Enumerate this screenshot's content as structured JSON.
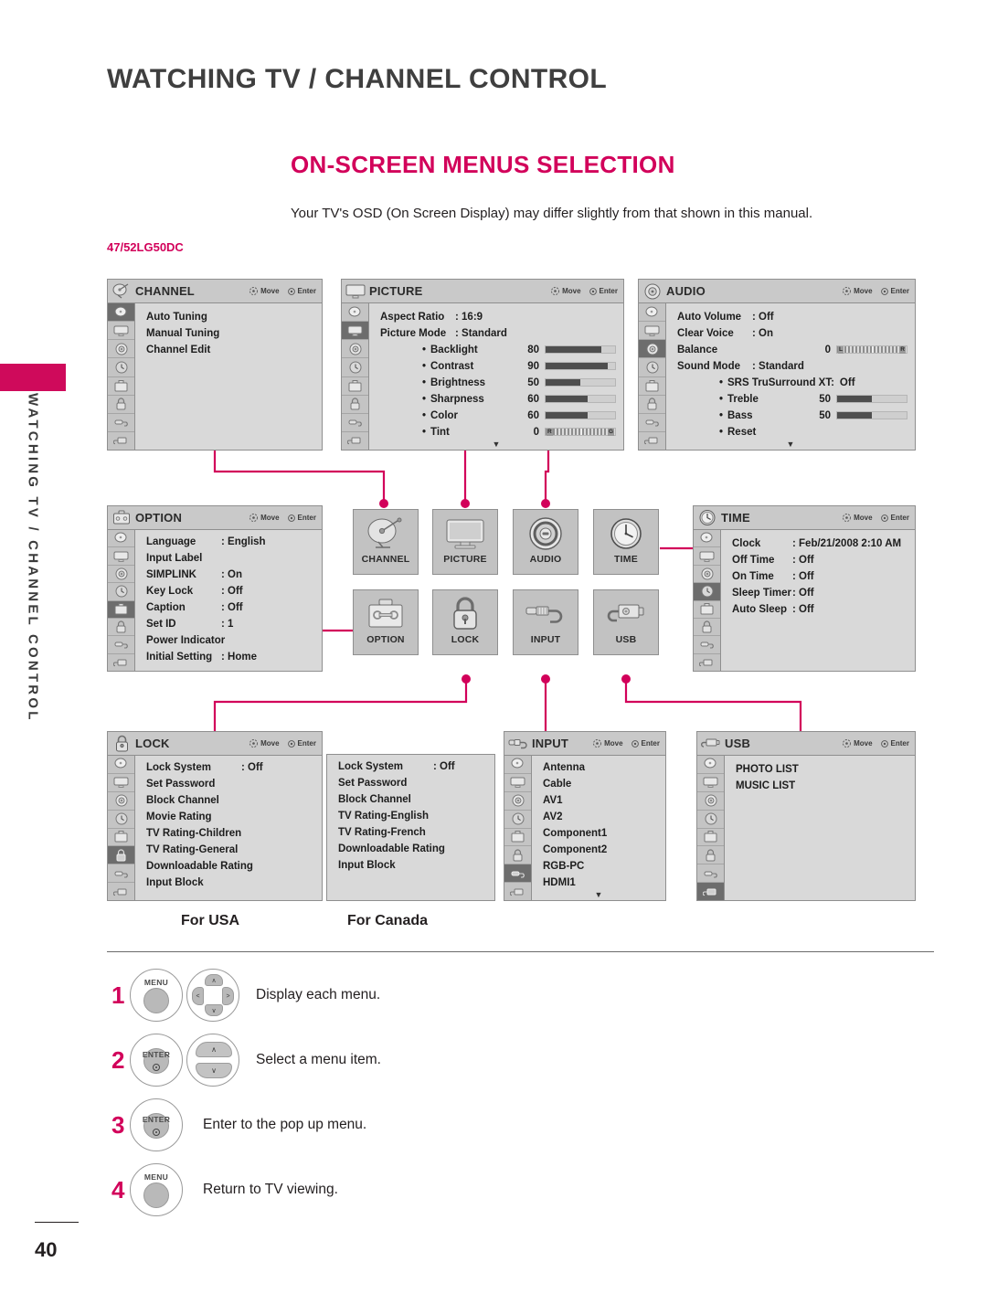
{
  "page": {
    "chapter_title": "WATCHING TV / CHANNEL CONTROL",
    "section_title": "ON-SCREEN MENUS SELECTION",
    "intro": "Your TV's OSD (On Screen Display) may differ slightly from that shown in this manual.",
    "model": "47/52LG50DC",
    "sidebar_vertical": "WATCHING TV / CHANNEL CONTROL",
    "page_number": "40",
    "accent_color": "#d2005a"
  },
  "osd_keys": {
    "move": "Move",
    "enter": "Enter"
  },
  "panels": {
    "channel": {
      "title": "CHANNEL",
      "items": [
        {
          "label": "Auto Tuning"
        },
        {
          "label": "Manual Tuning"
        },
        {
          "label": "Channel Edit"
        }
      ]
    },
    "picture": {
      "title": "PICTURE",
      "items": [
        {
          "label": "Aspect Ratio",
          "value": ": 16:9"
        },
        {
          "label": "Picture Mode",
          "value": ": Standard"
        }
      ],
      "sliders": [
        {
          "label": "Backlight",
          "value": "80",
          "pct": 80
        },
        {
          "label": "Contrast",
          "value": "90",
          "pct": 90
        },
        {
          "label": "Brightness",
          "value": "50",
          "pct": 50
        },
        {
          "label": "Sharpness",
          "value": "60",
          "pct": 60
        },
        {
          "label": "Color",
          "value": "60",
          "pct": 60
        }
      ],
      "tint": {
        "label": "Tint",
        "value": "0",
        "left": "R",
        "right": "G"
      }
    },
    "audio": {
      "title": "AUDIO",
      "items": [
        {
          "label": "Auto Volume",
          "value": ": Off"
        },
        {
          "label": "Clear Voice",
          "value": ": On"
        }
      ],
      "balance": {
        "label": "Balance",
        "value": "0",
        "left": "L",
        "right": "R"
      },
      "sound_mode": {
        "label": "Sound Mode",
        "value": ": Standard"
      },
      "sub_items": [
        {
          "label": "SRS TruSurround XT:",
          "value": "Off"
        }
      ],
      "sliders": [
        {
          "label": "Treble",
          "value": "50",
          "pct": 50
        },
        {
          "label": "Bass",
          "value": "50",
          "pct": 50
        }
      ],
      "reset": {
        "label": "Reset"
      }
    },
    "option": {
      "title": "OPTION",
      "items": [
        {
          "label": "Language",
          "value": ": English"
        },
        {
          "label": "Input Label",
          "value": ""
        },
        {
          "label": "SIMPLINK",
          "value": ": On"
        },
        {
          "label": "Key Lock",
          "value": ": Off"
        },
        {
          "label": "Caption",
          "value": ": Off"
        },
        {
          "label": "Set ID",
          "value": ": 1"
        },
        {
          "label": "Power Indicator",
          "value": ""
        },
        {
          "label": "Initial Setting",
          "value": ": Home"
        }
      ]
    },
    "time": {
      "title": "TIME",
      "items": [
        {
          "label": "Clock",
          "value": ": Feb/21/2008  2:10 AM"
        },
        {
          "label": "Off Time",
          "value": ": Off"
        },
        {
          "label": "On Time",
          "value": ": Off"
        },
        {
          "label": "Sleep Timer",
          "value": ": Off"
        },
        {
          "label": "Auto Sleep",
          "value": ": Off"
        }
      ]
    },
    "lock": {
      "title": "LOCK",
      "usa_items": [
        {
          "label": "Lock System",
          "value": ": Off"
        },
        {
          "label": "Set Password",
          "value": ""
        },
        {
          "label": "Block Channel",
          "value": ""
        },
        {
          "label": "Movie Rating",
          "value": ""
        },
        {
          "label": "TV Rating-Children",
          "value": ""
        },
        {
          "label": "TV Rating-General",
          "value": ""
        },
        {
          "label": "Downloadable Rating",
          "value": ""
        },
        {
          "label": "Input Block",
          "value": ""
        }
      ],
      "canada_items": [
        {
          "label": "Lock System",
          "value": ": Off"
        },
        {
          "label": "Set Password",
          "value": ""
        },
        {
          "label": "Block Channel",
          "value": ""
        },
        {
          "label": "TV Rating-English",
          "value": ""
        },
        {
          "label": "TV Rating-French",
          "value": ""
        },
        {
          "label": "Downloadable Rating",
          "value": ""
        },
        {
          "label": "Input Block",
          "value": ""
        }
      ]
    },
    "input": {
      "title": "INPUT",
      "items": [
        {
          "label": "Antenna"
        },
        {
          "label": "Cable"
        },
        {
          "label": "AV1"
        },
        {
          "label": "AV2"
        },
        {
          "label": "Component1"
        },
        {
          "label": "Component2"
        },
        {
          "label": "RGB-PC"
        },
        {
          "label": "HDMI1"
        }
      ]
    },
    "usb": {
      "title": "USB",
      "items": [
        {
          "label": "PHOTO LIST"
        },
        {
          "label": "MUSIC LIST"
        }
      ]
    }
  },
  "tiles": [
    {
      "label": "CHANNEL",
      "icon": "satellite-dish-icon"
    },
    {
      "label": "PICTURE",
      "icon": "television-icon"
    },
    {
      "label": "AUDIO",
      "icon": "speaker-icon"
    },
    {
      "label": "TIME",
      "icon": "clock-icon"
    },
    {
      "label": "OPTION",
      "icon": "toolbox-icon"
    },
    {
      "label": "LOCK",
      "icon": "padlock-icon"
    },
    {
      "label": "INPUT",
      "icon": "rca-plug-icon"
    },
    {
      "label": "USB",
      "icon": "usb-plug-icon"
    }
  ],
  "captions": {
    "usa": "For USA",
    "canada": "For Canada"
  },
  "steps": [
    {
      "num": "1",
      "button": "MENU",
      "control": "dpad",
      "text": "Display each menu."
    },
    {
      "num": "2",
      "button": "ENTER",
      "control": "updown",
      "text": "Select a menu item."
    },
    {
      "num": "3",
      "button": "ENTER",
      "control": "none",
      "text": "Enter to the pop up menu."
    },
    {
      "num": "4",
      "button": "MENU",
      "control": "none",
      "text": "Return to TV viewing."
    }
  ]
}
